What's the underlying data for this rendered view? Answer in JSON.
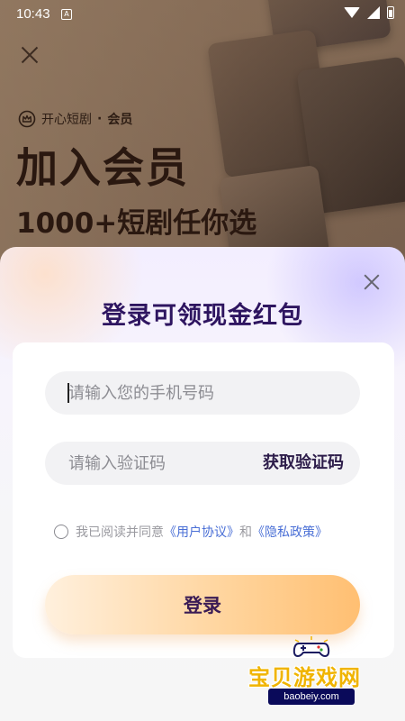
{
  "status_bar": {
    "time": "10:43",
    "notification_glyph": "A",
    "icons": [
      "wifi-icon",
      "signal-icon",
      "battery-icon"
    ]
  },
  "background_page": {
    "brand_name": "开心短剧",
    "brand_separator": "·",
    "brand_tag": "会员",
    "hero_title": "加入会员",
    "hero_subtitle": "1000+短剧任你选"
  },
  "login_sheet": {
    "title": "登录可领现金红包",
    "phone_placeholder": "请输入您的手机号码",
    "phone_value": "",
    "code_placeholder": "请输入验证码",
    "code_value": "",
    "get_code_label": "获取验证码",
    "agreement": {
      "prefix": "我已阅读并同意",
      "user_agreement": "《用户协议》",
      "conjunction": "和",
      "privacy_policy": "《隐私政策》",
      "checked": false
    },
    "login_label": "登录"
  },
  "watermark": {
    "name": "宝贝游戏网",
    "url": "baobeiy.com"
  },
  "colors": {
    "title_purple": "#2e1560",
    "link_blue": "#4a6fd6",
    "button_gradient_end": "#ffbf72",
    "watermark_yellow": "#f0b400"
  }
}
